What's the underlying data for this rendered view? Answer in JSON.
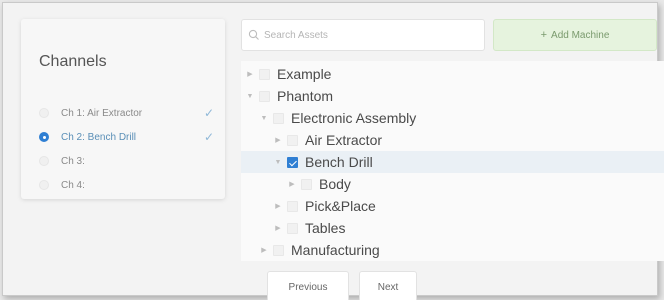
{
  "channels": {
    "title": "Channels",
    "items": [
      {
        "label": "Ch 1: Air Extractor",
        "selected": false,
        "check": "✓"
      },
      {
        "label": "Ch 2: Bench Drill",
        "selected": true,
        "check": "✓"
      },
      {
        "label": "Ch 3:",
        "selected": false,
        "check": ""
      },
      {
        "label": "Ch 4:",
        "selected": false,
        "check": ""
      }
    ]
  },
  "search": {
    "placeholder": "Search Assets",
    "value": ""
  },
  "add_machine": {
    "plus": "+",
    "label": "Add Machine"
  },
  "tree": {
    "items": [
      {
        "label": "Example",
        "checked": false
      },
      {
        "label": "Phantom",
        "checked": false
      },
      {
        "label": "Electronic Assembly",
        "checked": false
      },
      {
        "label": "Air Extractor",
        "checked": false
      },
      {
        "label": "Bench Drill",
        "checked": true
      },
      {
        "label": "Body",
        "checked": false
      },
      {
        "label": "Pick&Place",
        "checked": false
      },
      {
        "label": "Tables",
        "checked": false
      },
      {
        "label": "Manufacturing",
        "checked": false
      }
    ]
  },
  "pager": {
    "previous": "Previous",
    "next": "Next"
  },
  "colors": {
    "accent": "#2f7fd3",
    "add_button_bg": "#e6f3de",
    "highlight_row": "#eaf0f5"
  }
}
